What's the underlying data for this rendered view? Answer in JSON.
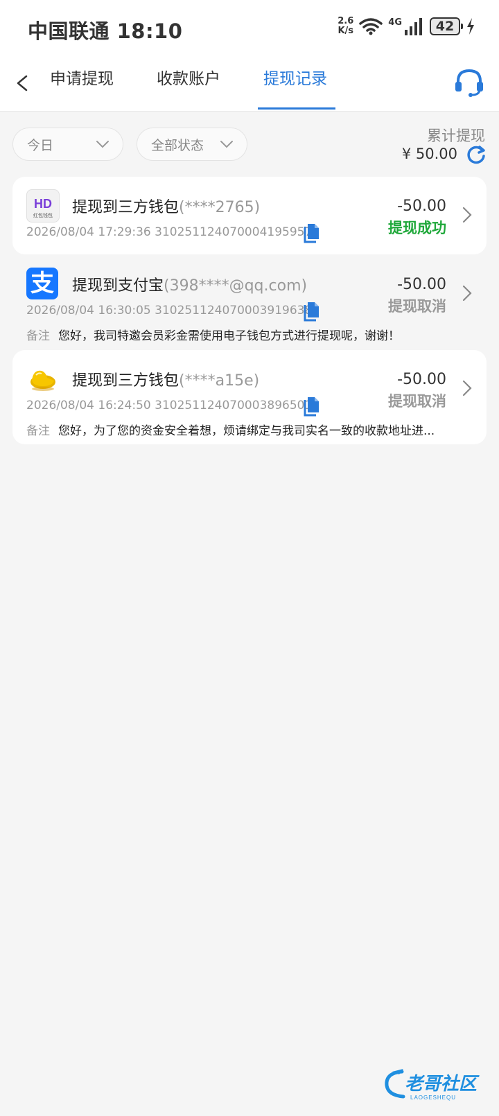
{
  "status_bar": {
    "carrier_time": "中国联通 18:10",
    "speed_value": "2.6",
    "speed_unit": "K/s",
    "network": "4G",
    "battery": "42"
  },
  "nav": {
    "tabs": [
      "申请提现",
      "收款账户",
      "提现记录"
    ],
    "active_tab": "提现记录"
  },
  "filters": {
    "date": "今日",
    "status": "全部状态"
  },
  "total": {
    "label": "累计提现",
    "amount": "¥ 50.00"
  },
  "records": [
    {
      "title": "提现到三方钱包",
      "account": "(****2765)",
      "datetime_id": "2026/08/04 17:29:36 310251124070004195957",
      "amount": "-50.00",
      "status": "提现成功",
      "logo": "hd-wallet-logo",
      "logo_text": "红包钱包"
    },
    {
      "title": "提现到支付宝",
      "account": "(398****@qq.com)",
      "datetime_id": "2026/08/04 16:30:05 310251124070003919638",
      "amount": "-50.00",
      "status": "提现取消",
      "logo": "alipay-logo",
      "logo_text": "支",
      "remark_label": "备注",
      "remark": "您好，我司特邀会员彩金需使用电子钱包方式进行提现呢，谢谢！"
    },
    {
      "title": "提现到三方钱包",
      "account": "(****a15e)",
      "datetime_id": "2026/08/04 16:24:50 310251124070003896501",
      "amount": "-50.00",
      "status": "提现取消",
      "logo": "gold-shoe-logo",
      "remark_label": "备注",
      "remark": "您好，为了您的资金安全着想，烦请绑定与我司实名一致的收款地址进..."
    }
  ],
  "watermark": {
    "title": "老哥社区",
    "subtitle": "LAOGESHEQU"
  },
  "colors": {
    "accent": "#2a7ad9",
    "success": "#1fa83a",
    "muted": "#999999"
  }
}
